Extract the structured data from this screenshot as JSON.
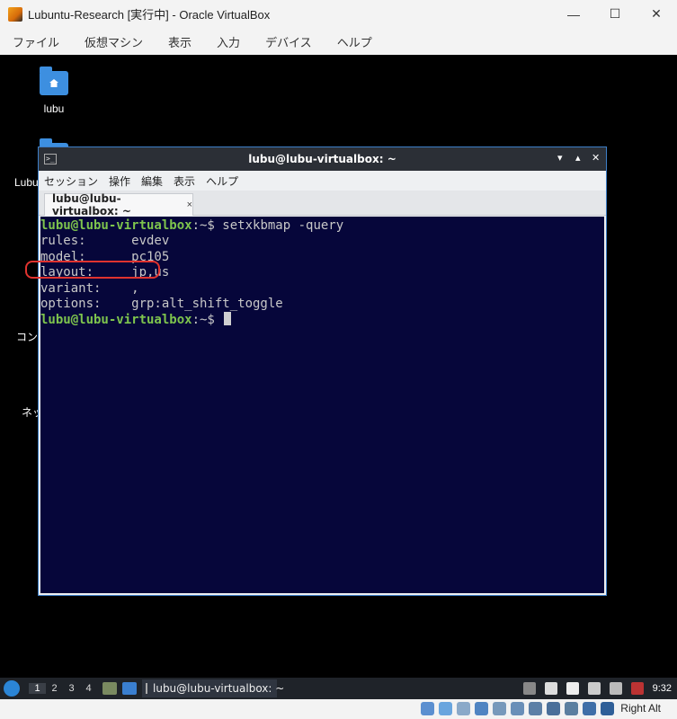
{
  "window": {
    "title": "Lubuntu-Research [実行中] - Oracle VirtualBox",
    "minimize": "—",
    "maximize": "☐",
    "close": "✕"
  },
  "vb_menu": [
    "ファイル",
    "仮想マシン",
    "表示",
    "入力",
    "デバイス",
    "ヘルプ"
  ],
  "desktop": {
    "home_icon_label": "lubu",
    "partial_labels": [
      "Lubu",
      "コン",
      "ネッ"
    ]
  },
  "terminal": {
    "title": "lubu@lubu-virtualbox: ~",
    "title_icon": ">_",
    "menu": [
      "セッション",
      "操作",
      "編集",
      "表示",
      "ヘルプ"
    ],
    "tab_label": "lubu@lubu-virtualbox: ~",
    "tab_close": "×",
    "prompt_user": "lubu@lubu-virtualbox",
    "prompt_path": ":~$ ",
    "command": "setxkbmap -query",
    "output": [
      "rules:      evdev",
      "model:      pc105",
      "layout:     jp,us",
      "variant:    ,",
      "options:    grp:alt_shift_toggle"
    ],
    "annotation_color": "#e0332f"
  },
  "guest_taskbar": {
    "workspaces": [
      "1",
      "2",
      "3",
      "4"
    ],
    "active_workspace": "1",
    "task_label": "lubu@lubu-virtualbox: ~",
    "clock": "9:32"
  },
  "vb_statusbar": {
    "host_key": "Right Alt"
  }
}
